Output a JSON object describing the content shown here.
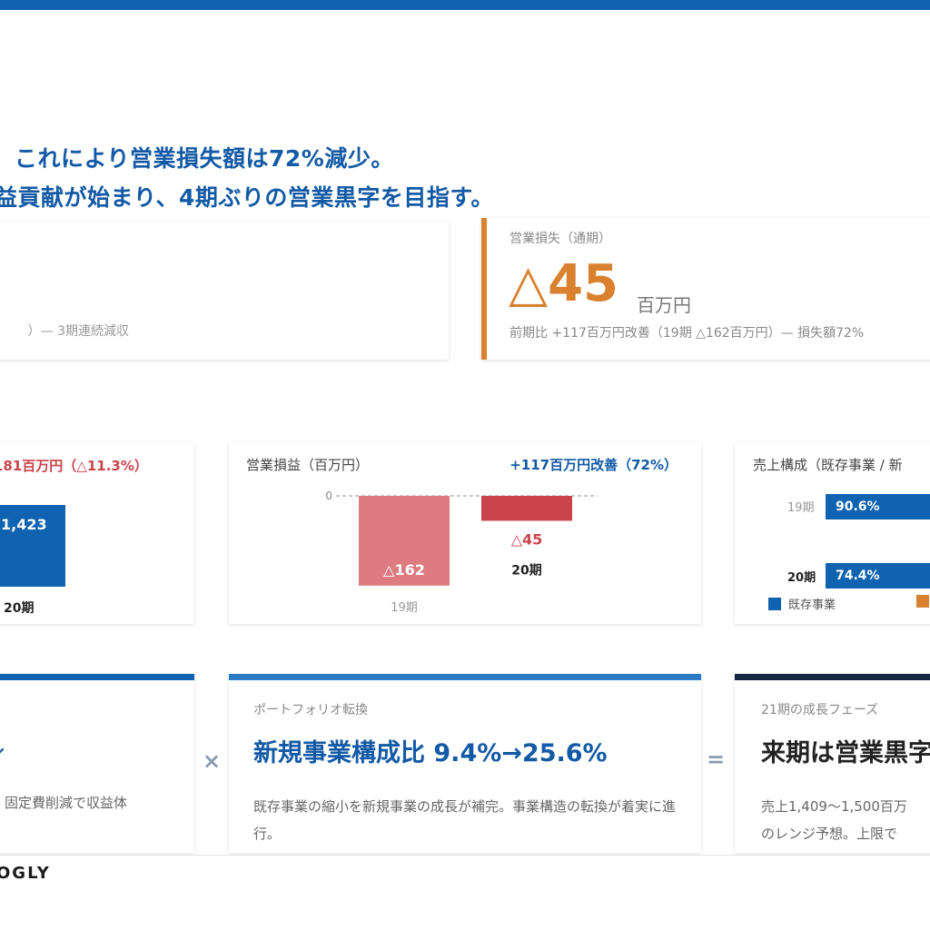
{
  "headline": {
    "line1": "これにより営業損失額は72%減少。",
    "line2": "益貢献が始まり、4期ぶりの営業黒字を目指す。"
  },
  "kpi_left": {
    "note": "）— 3期連続減収"
  },
  "kpi_right": {
    "label": "営業損失（通期）",
    "value": "△45",
    "unit": "百万円",
    "note": "前期比 +117百万円改善（19期 △162百万円）— 損失額72%"
  },
  "card_revenue": {
    "header": "181百万円（△11.3%）",
    "bar_value": "1,423",
    "period": "20期"
  },
  "card_operating": {
    "title": "営業損益（百万円）",
    "subtitle": "+117百万円改善（72%）"
  },
  "chart_data": {
    "type": "bar",
    "categories": [
      "19期",
      "20期"
    ],
    "values": [
      -162,
      -45
    ],
    "value_labels": [
      "△162",
      "△45"
    ],
    "zero_label": "0",
    "colors": {
      "bar_19": "#dd7b80",
      "bar_20": "#c9434b",
      "label_20": "#c9434b"
    }
  },
  "card_composition": {
    "title": "売上構成（既存事業 / 新",
    "rows": [
      {
        "period": "19期",
        "value": "90.6%"
      },
      {
        "period": "20期",
        "value": "74.4%"
      }
    ],
    "legend": [
      {
        "label": "既存事業",
        "color": "#0f63b0"
      },
      {
        "label": "",
        "color": "#d9812f"
      }
    ]
  },
  "bottom_left": {
    "arrow": "↓",
    "desc": "固定費削減で収益体"
  },
  "bottom_mid": {
    "label": "ポートフォリオ転換",
    "title": "新規事業構成比 9.4%→25.6%",
    "desc": "既存事業の縮小を新規事業の成長が補完。事業構造の転換が着実に進行。"
  },
  "operators": {
    "times": "×",
    "equals": "="
  },
  "bottom_right": {
    "label": "21期の成長フェーズ",
    "title": "来期は営業黒字",
    "desc_line1": "売上1,409〜1,500百万",
    "desc_line2": "のレンジ予想。上限で"
  },
  "footer": {
    "logo": "OGLY"
  },
  "colors": {
    "brand_blue": "#0f63b0",
    "accent_orange": "#d9812f",
    "negative_red": "#c9434b"
  }
}
